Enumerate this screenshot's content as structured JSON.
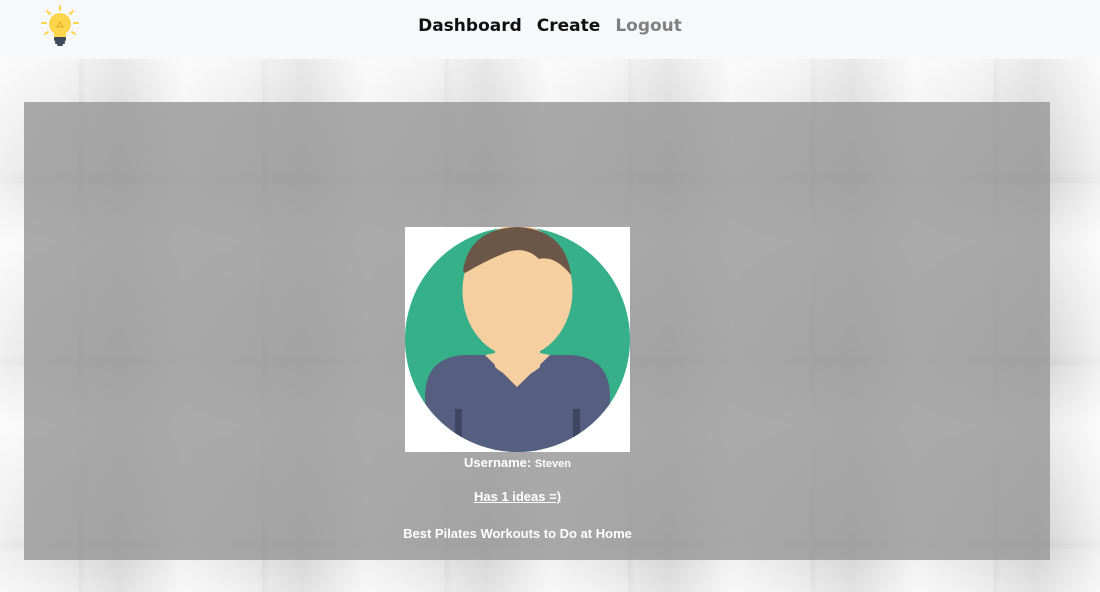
{
  "nav": {
    "logo_icon": "lightbulb-icon",
    "links": [
      {
        "label": "Dashboard"
      },
      {
        "label": "Create"
      },
      {
        "label": "Logout"
      }
    ]
  },
  "profile": {
    "avatar_icon": "user-avatar-icon",
    "username_label": "Username:",
    "username_value": "Steven",
    "ideas_link": "Has 1 ideas =)",
    "idea_title": "Best Pilates Workouts to Do at Home"
  },
  "colors": {
    "logo_bulb": "#fdd54a",
    "avatar_bg": "#35b088",
    "avatar_skin": "#f6cfa0",
    "avatar_hair": "#6b5647",
    "avatar_shirt": "#565f80"
  }
}
